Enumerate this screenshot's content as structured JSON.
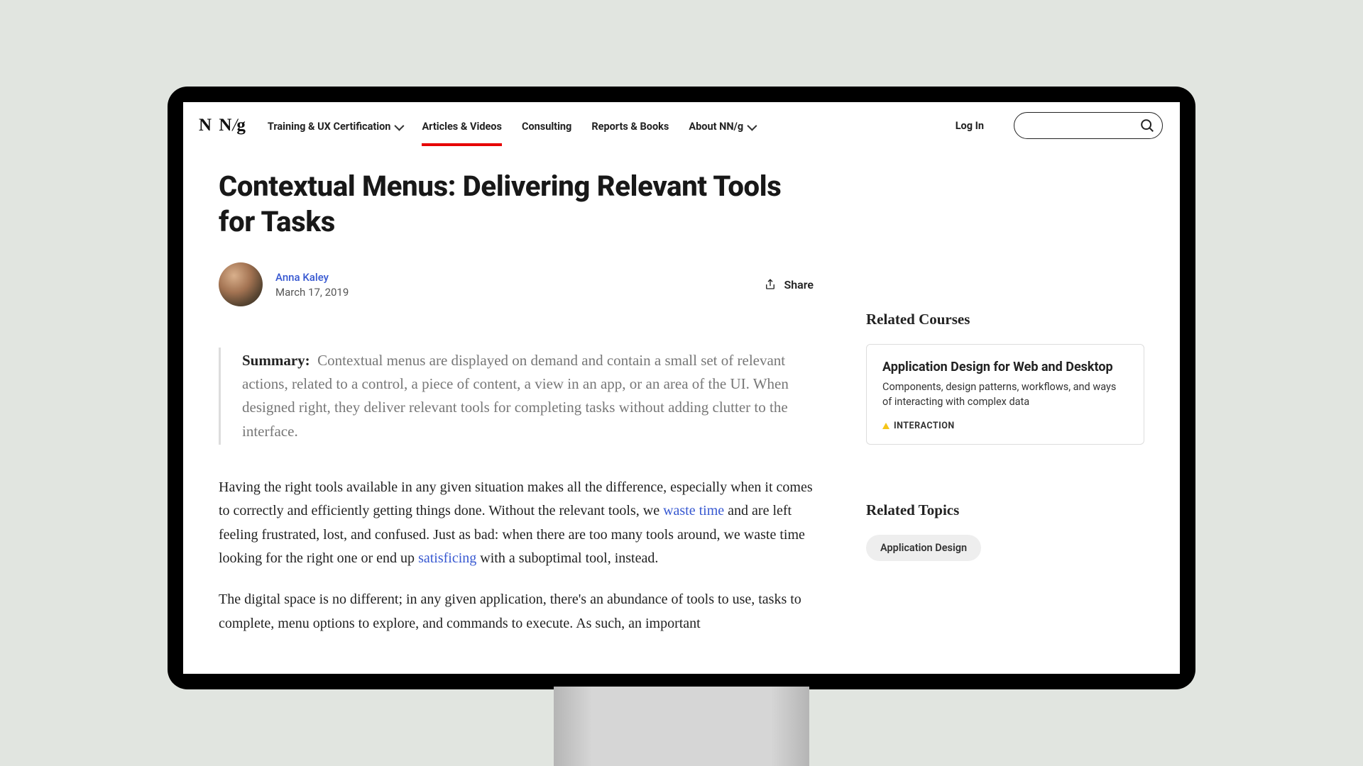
{
  "logo": {
    "text": "NN/g"
  },
  "nav": {
    "items": [
      {
        "label": "Training & UX Certification",
        "hasDropdown": true,
        "active": false
      },
      {
        "label": "Articles & Videos",
        "hasDropdown": false,
        "active": true
      },
      {
        "label": "Consulting",
        "hasDropdown": false,
        "active": false
      },
      {
        "label": "Reports & Books",
        "hasDropdown": false,
        "active": false
      },
      {
        "label": "About NN/g",
        "hasDropdown": true,
        "active": false
      }
    ],
    "login": "Log In"
  },
  "article": {
    "title": "Contextual Menus: Delivering Relevant Tools for Tasks",
    "author": "Anna Kaley",
    "date": "March 17, 2019",
    "share_label": "Share",
    "summary_label": "Summary:",
    "summary": "Contextual menus are displayed on demand and contain a small set of relevant actions, related to a control, a piece of content, a view in an app, or an area of the UI. When designed right, they deliver relevant tools for completing tasks without adding clutter to the interface.",
    "body": {
      "p1_a": "Having the right tools available in any given situation makes all the difference, especially when it comes to correctly and efficiently getting things done. Without the relevant tools, we ",
      "link_waste": "waste time",
      "p1_b": " and are left feeling frustrated, lost, and confused. Just as bad: when there are too many tools around, we waste time looking for the right one or end up ",
      "link_sat": "satisficing",
      "p1_c": " with a suboptimal tool, instead.",
      "p2": "The digital space is no different; in any given application, there's an abundance of tools to use, tasks to complete, menu options to explore, and commands to execute. As such, an important"
    }
  },
  "sidebar": {
    "courses_heading": "Related Courses",
    "course": {
      "title": "Application Design for Web and Desktop",
      "desc": "Components, design patterns, workflows, and ways of interacting with complex data",
      "tag": "INTERACTION"
    },
    "topics_heading": "Related Topics",
    "topic": "Application Design"
  }
}
